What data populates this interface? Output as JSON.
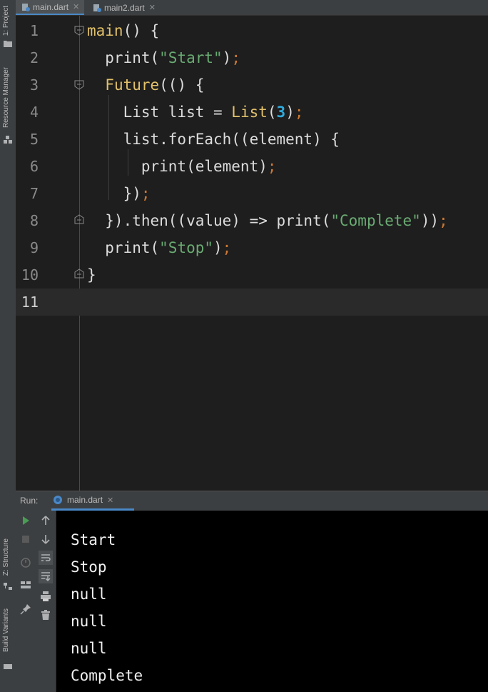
{
  "sidebar_left": {
    "project_label": "1: Project",
    "resource_label": "Resource Manager",
    "structure_label": "Z: Structure",
    "build_label": "Build Variants"
  },
  "tabs": [
    {
      "label": "main.dart",
      "active": true,
      "icon": "dart-file-icon"
    },
    {
      "label": "main2.dart",
      "active": false,
      "icon": "dart-file-icon"
    }
  ],
  "editor": {
    "current_line": 11,
    "lines": [
      {
        "n": "1"
      },
      {
        "n": "2"
      },
      {
        "n": "3"
      },
      {
        "n": "4"
      },
      {
        "n": "5"
      },
      {
        "n": "6"
      },
      {
        "n": "7"
      },
      {
        "n": "8"
      },
      {
        "n": "9"
      },
      {
        "n": "10"
      },
      {
        "n": "11"
      }
    ],
    "code": {
      "l1_a": "main",
      "l1_b": "() {",
      "l2_a": "  print(",
      "l2_b": "\"Start\"",
      "l2_c": ")",
      "l2_d": ";",
      "l3_a": "  ",
      "l3_b": "Future",
      "l3_c": "(() {",
      "l4_a": "    List list = ",
      "l4_b": "List",
      "l4_c": "(",
      "l4_d": "3",
      "l4_e": ")",
      "l4_f": ";",
      "l5_a": "    list.forEach((element) {",
      "l6_a": "      print(element)",
      "l6_b": ";",
      "l7_a": "    })",
      "l7_b": ";",
      "l8_a": "  }).then((value) => print(",
      "l8_b": "\"Complete\"",
      "l8_c": "))",
      "l8_d": ";",
      "l9_a": "  print(",
      "l9_b": "\"Stop\"",
      "l9_c": ")",
      "l9_d": ";",
      "l10_a": "}"
    }
  },
  "run": {
    "label": "Run:",
    "tab_label": "main.dart",
    "output": [
      "Start",
      "Stop",
      "null",
      "null",
      "null",
      "Complete"
    ]
  },
  "colors": {
    "keyword": "#e2c16b",
    "string": "#6aab73",
    "semicolon": "#cc7832",
    "number": "#31a9dc",
    "accent": "#4a88c7"
  }
}
